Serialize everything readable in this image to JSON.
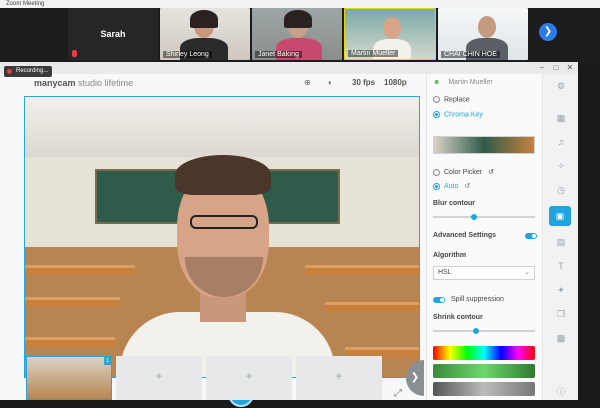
{
  "zoom": {
    "title": "Zoom Meeting",
    "participants": [
      "Sarah",
      "Shirley Leong",
      "Janet Balong",
      "Martin Mueller",
      "CHAI CHIN HOE"
    ]
  },
  "manycam": {
    "recording_label": "Recording...",
    "logo_brand": "manycam",
    "logo_edition": "studio lifetime",
    "fps": "30 fps",
    "resolution": "1080p",
    "user": "Martin Mueller",
    "options": {
      "replace": "Replace",
      "chroma_key": "Chroma Key",
      "color_picker": "Color Picker",
      "auto": "Auto",
      "blur_contour": "Blur contour",
      "advanced_settings": "Advanced Settings",
      "algorithm": "Algorithm",
      "algorithm_value": "HSL",
      "spill_suppression": "Spill suppression",
      "shrink_contour": "Shrink contour"
    },
    "thumb_badge": "1",
    "accent_color": "#1fa6e0"
  }
}
